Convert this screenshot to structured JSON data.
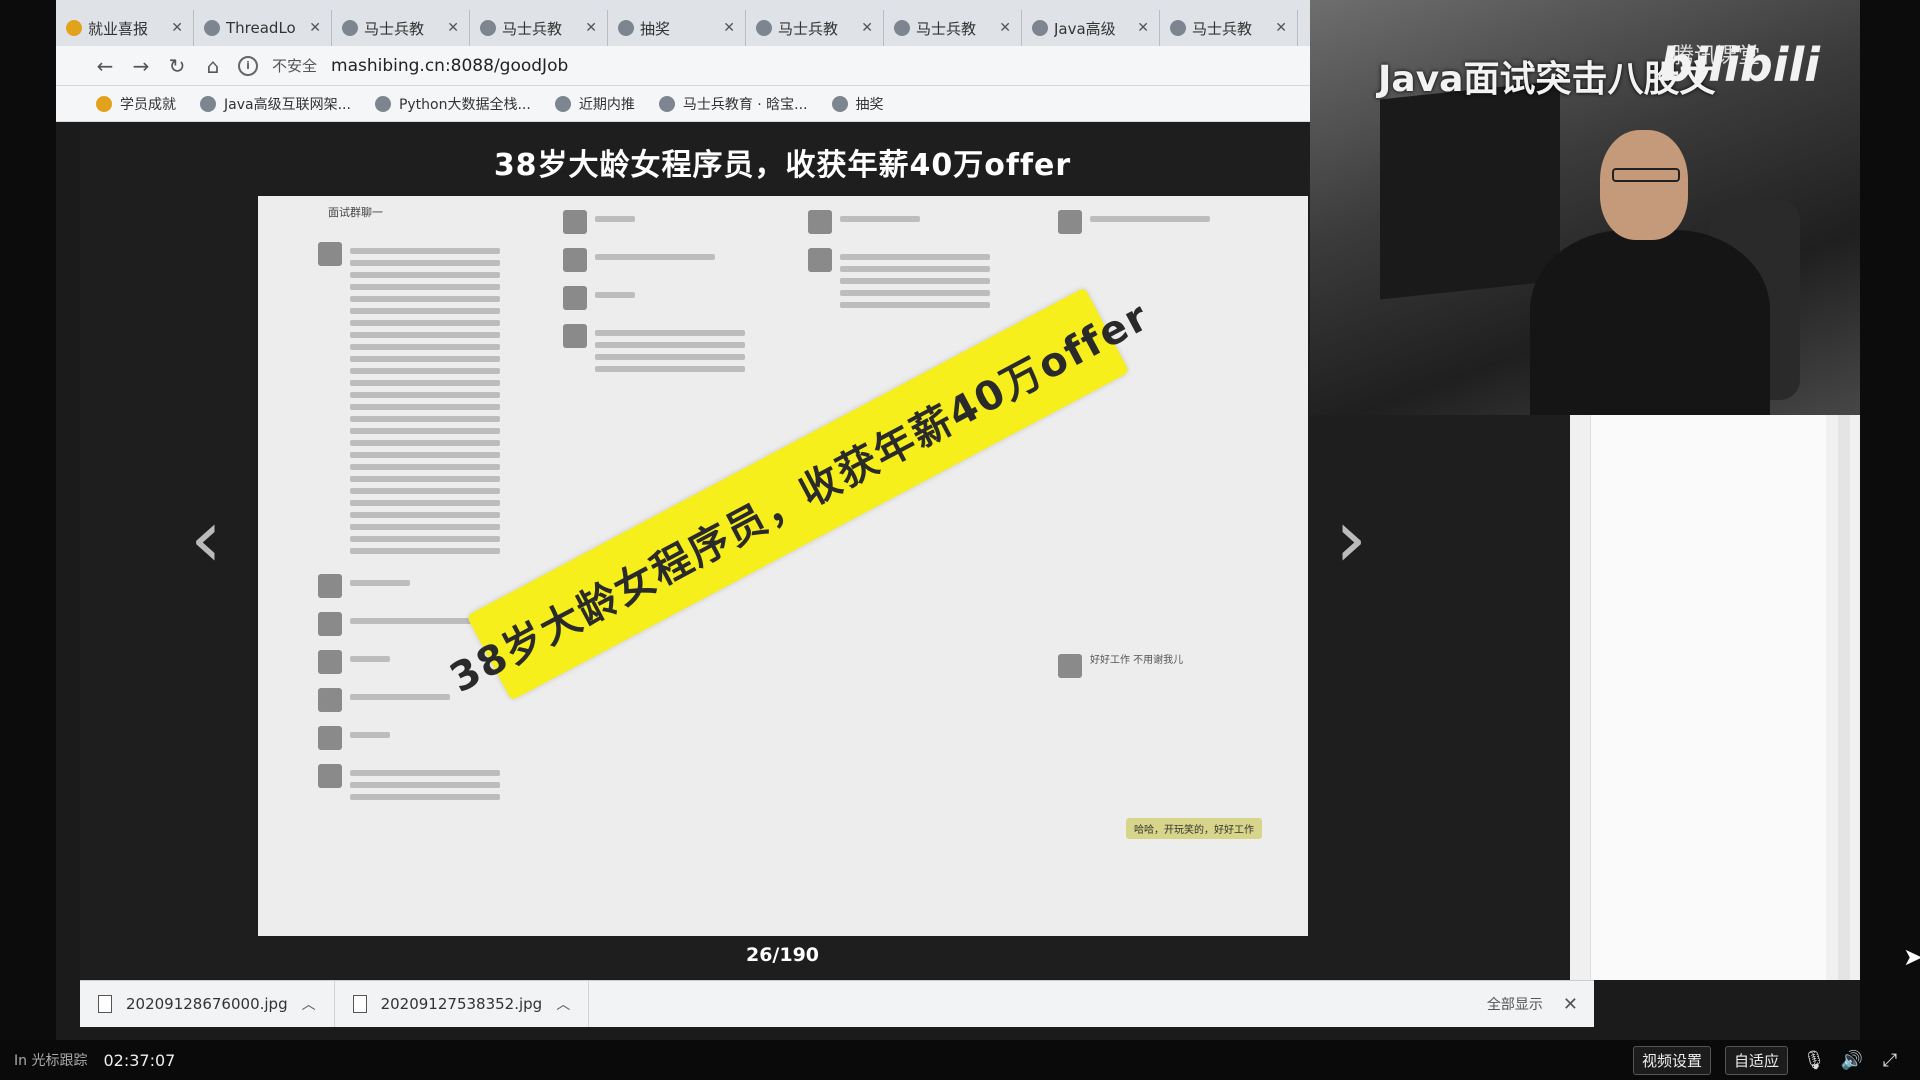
{
  "browser": {
    "tabs": [
      {
        "label": "就业喜报",
        "icon": "fire-icon"
      },
      {
        "label": "ThreadLo",
        "icon": "mascot-icon"
      },
      {
        "label": "马士兵教",
        "icon": "mascot-icon"
      },
      {
        "label": "马士兵教",
        "icon": "mascot-icon"
      },
      {
        "label": "抽奖",
        "icon": "globe-icon"
      },
      {
        "label": "马士兵教",
        "icon": "globe-icon"
      },
      {
        "label": "马士兵教",
        "icon": "mascot-icon"
      },
      {
        "label": "Java高级",
        "icon": "shield-icon"
      },
      {
        "label": "马士兵教",
        "icon": "mascot-icon"
      }
    ],
    "address": {
      "insecure_label": "不安全",
      "url": "mashibing.cn:8088/goodJob"
    },
    "bookmarks": [
      {
        "label": "学员成就",
        "icon": "fire-icon"
      },
      {
        "label": "Java高级互联网架...",
        "icon": "shield-icon"
      },
      {
        "label": "Python大数据全栈...",
        "icon": "shield-icon"
      },
      {
        "label": "近期内推",
        "icon": "mascot-icon"
      },
      {
        "label": "马士兵教育 · 晗宝...",
        "icon": "globe-icon"
      },
      {
        "label": "抽奖",
        "icon": "globe-icon"
      }
    ]
  },
  "viewer": {
    "title": "38岁大龄女程序员，收获年薪40万offer",
    "banner_text": "38岁大龄女程序员，收获年薪40万offer",
    "counter": "26/190",
    "chat_snippets": {
      "header": "面试群聊一",
      "reply_1": "好好工作 不用谢我儿",
      "reply_2": "哈哈，开玩笑的，好好工作"
    }
  },
  "overlay": {
    "title": "Java面试突击八股文",
    "watermark": "bilibili",
    "tencent": "腾讯课堂"
  },
  "downloads": {
    "items": [
      {
        "filename": "20209128676000.jpg"
      },
      {
        "filename": "20209127538352.jpg"
      }
    ],
    "show_all": "全部显示"
  },
  "player": {
    "left_label": "In 光标跟踪",
    "time": "02:37:07",
    "video_settings": "视频设置",
    "fit": "自适应"
  }
}
